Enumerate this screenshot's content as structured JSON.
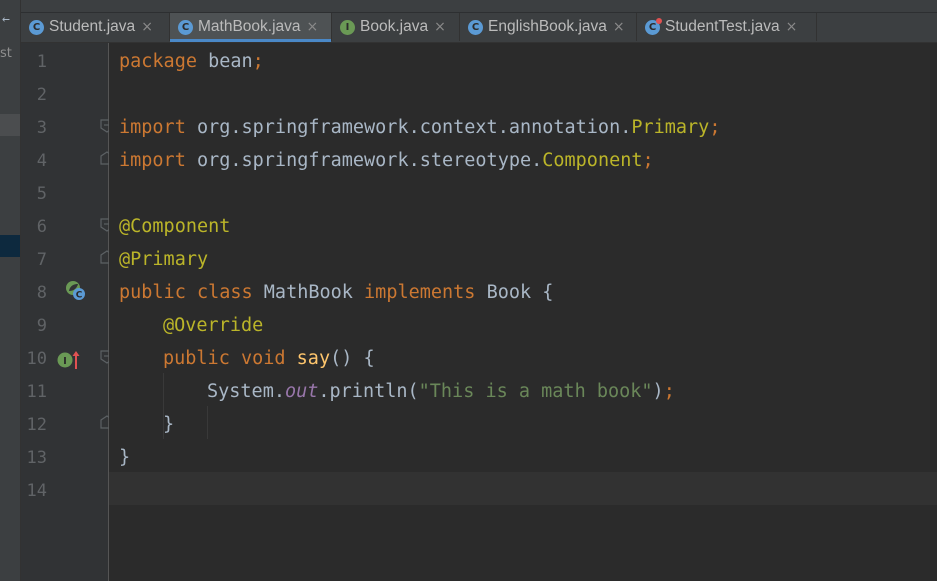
{
  "tabs": [
    {
      "label": "Student.java",
      "icon": "class-icon",
      "icon_letter": "C",
      "active": false
    },
    {
      "label": "MathBook.java",
      "icon": "class-icon",
      "icon_letter": "C",
      "active": true
    },
    {
      "label": "Book.java",
      "icon": "interface-icon",
      "icon_letter": "I",
      "active": false
    },
    {
      "label": "EnglishBook.java",
      "icon": "class-icon",
      "icon_letter": "C",
      "active": false
    },
    {
      "label": "StudentTest.java",
      "icon": "test-class-icon",
      "icon_letter": "C",
      "active": false
    }
  ],
  "tab_close_glyph": "×",
  "left_panel": {
    "arrow": "←",
    "text": "st"
  },
  "gutter": {
    "line_numbers": [
      "1",
      "2",
      "3",
      "4",
      "5",
      "6",
      "7",
      "8",
      "9",
      "10",
      "11",
      "12",
      "13",
      "14"
    ],
    "class_icon_letter": "C",
    "interface_icon_letter": "I"
  },
  "code": {
    "l1": {
      "kw": "package",
      "rest": " bean",
      "semi": ";"
    },
    "l3": {
      "kw": "import",
      "rest": " org.springframework.context.annotation.",
      "cls": "Primary",
      "semi": ";"
    },
    "l4": {
      "kw": "import",
      "rest": " org.springframework.stereotype.",
      "cls": "Component",
      "semi": ";"
    },
    "l6": {
      "ann": "@Component"
    },
    "l7": {
      "ann": "@Primary"
    },
    "l8": {
      "kw1": "public class",
      "name": " MathBook ",
      "kw2": "implements",
      "rest": " Book {"
    },
    "l9": {
      "ann": "@Override"
    },
    "l10": {
      "kw": "public void",
      "fn": "say",
      "rest": "() {"
    },
    "l11": {
      "obj": "System.",
      "field": "out",
      "call": ".println(",
      "str": "\"This is a math book\"",
      "close": ")",
      "semi": ";"
    },
    "l12": {
      "rest": "}"
    },
    "l13": {
      "rest": "}"
    }
  },
  "colors": {
    "background": "#2b2b2b",
    "keyword": "#cc7832",
    "annotation": "#bbb529",
    "method": "#ffc66d",
    "string": "#6a8759",
    "field": "#9876aa",
    "text": "#a9b7c6",
    "active_tab_underline": "#4a88c7"
  }
}
